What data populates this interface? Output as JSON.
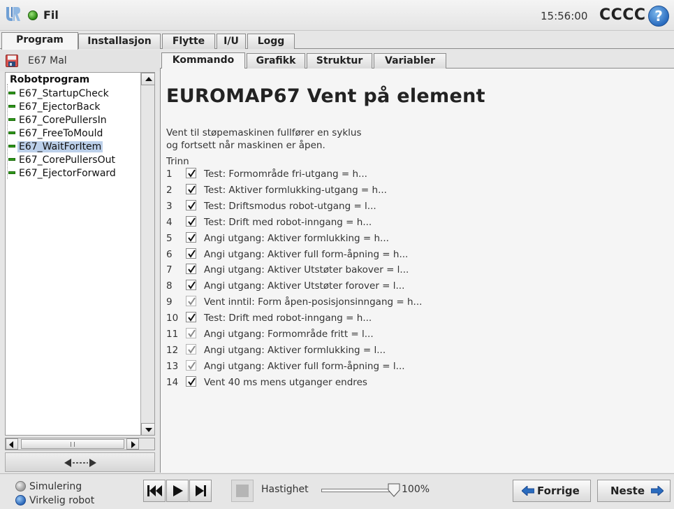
{
  "titlebar": {
    "file_label": "Fil",
    "clock": "15:56:00",
    "robot_name": "CCCC",
    "help_label": "?",
    "status_color": "#2c8a12",
    "logo_icon": "ur-logo-icon"
  },
  "main_tabs": [
    {
      "label": "Program",
      "active": true
    },
    {
      "label": "Installasjon",
      "active": false
    },
    {
      "label": "Flytte",
      "active": false
    },
    {
      "label": "I/U",
      "active": false
    },
    {
      "label": "Logg",
      "active": false
    }
  ],
  "left_panel": {
    "program_name": "E67 Mal",
    "tree": {
      "root": "Robotprogram",
      "items": [
        {
          "label": "E67_StartupCheck",
          "selected": false
        },
        {
          "label": "E67_EjectorBack",
          "selected": false
        },
        {
          "label": "E67_CorePullersIn",
          "selected": false
        },
        {
          "label": "E67_FreeToMould",
          "selected": false
        },
        {
          "label": "E67_WaitForItem",
          "selected": true
        },
        {
          "label": "E67_CorePullersOut",
          "selected": false
        },
        {
          "label": "E67_EjectorForward",
          "selected": false
        }
      ]
    }
  },
  "sub_tabs": [
    {
      "label": "Kommando",
      "active": true
    },
    {
      "label": "Grafikk",
      "active": false
    },
    {
      "label": "Struktur",
      "active": false
    },
    {
      "label": "Variabler",
      "active": false
    }
  ],
  "content": {
    "title": "EUROMAP67 Vent på element",
    "desc_line1": "Vent til støpemaskinen fullfører en syklus",
    "desc_line2": "og fortsett når maskinen er åpen.",
    "steps_label": "Trinn",
    "steps": [
      {
        "num": "1",
        "text": "Test: Formområde fri-utgang = h...",
        "checked": true,
        "dim": false
      },
      {
        "num": "2",
        "text": "Test: Aktiver formlukking-utgang = h...",
        "checked": true,
        "dim": false
      },
      {
        "num": "3",
        "text": "Test: Driftsmodus robot-utgang = l...",
        "checked": true,
        "dim": false
      },
      {
        "num": "4",
        "text": "Test: Drift med robot-inngang = h...",
        "checked": true,
        "dim": false
      },
      {
        "num": "5",
        "text": "Angi utgang: Aktiver formlukking = h...",
        "checked": true,
        "dim": false
      },
      {
        "num": "6",
        "text": "Angi utgang: Aktiver full form-åpning = h...",
        "checked": true,
        "dim": false
      },
      {
        "num": "7",
        "text": "Angi utgang: Aktiver Utstøter bakover = l...",
        "checked": true,
        "dim": false
      },
      {
        "num": "8",
        "text": "Angi utgang: Aktiver Utstøter forover = l...",
        "checked": true,
        "dim": false
      },
      {
        "num": "9",
        "text": "Vent inntil: Form åpen-posisjonsinngang = h...",
        "checked": true,
        "dim": true
      },
      {
        "num": "10",
        "text": "Test: Drift med robot-inngang = h...",
        "checked": true,
        "dim": false
      },
      {
        "num": "11",
        "text": "Angi utgang: Formområde fritt = l...",
        "checked": true,
        "dim": true
      },
      {
        "num": "12",
        "text": "Angi utgang: Aktiver formlukking = l...",
        "checked": true,
        "dim": true
      },
      {
        "num": "13",
        "text": "Angi utgang: Aktiver full form-åpning = l...",
        "checked": true,
        "dim": true
      },
      {
        "num": "14",
        "text": "Vent 40 ms mens utganger endres",
        "checked": true,
        "dim": false
      }
    ]
  },
  "bottombar": {
    "sim_label": "Simulering",
    "real_label": "Virkelig robot",
    "speed_label": "Hastighet",
    "speed_value": "100%",
    "speed_fraction": 1.0,
    "prev_label": "Forrige",
    "next_label": "Neste",
    "arrow_color": "#2a6cbf"
  }
}
